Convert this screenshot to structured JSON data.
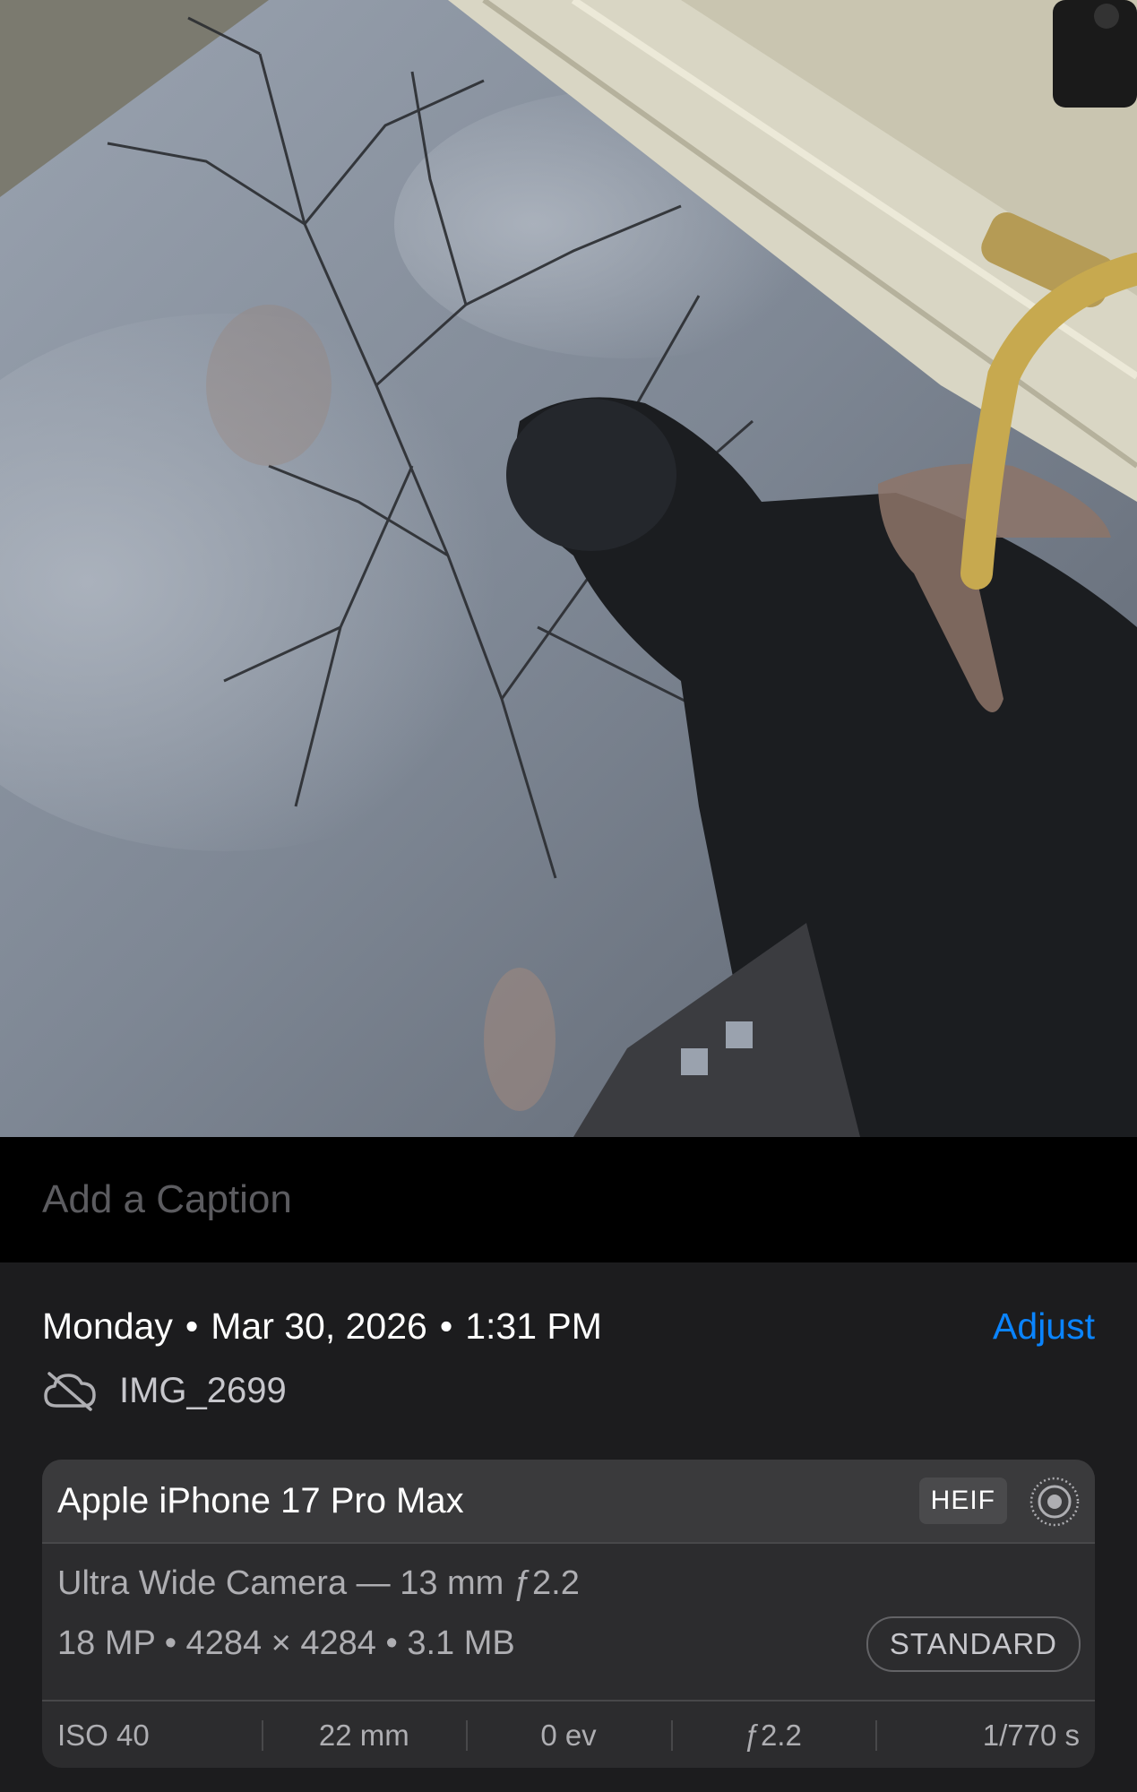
{
  "caption": {
    "placeholder": "Add a Caption"
  },
  "info": {
    "day": "Monday",
    "date": "Mar 30, 2026",
    "time": "1:31 PM",
    "separator": "•",
    "adjust_label": "Adjust",
    "filename": "IMG_2699",
    "cloud_icon": "icloud-slash-icon"
  },
  "camera": {
    "device": "Apple iPhone 17 Pro Max",
    "format": "HEIF",
    "live_icon": "live-photo-icon",
    "lens": "Ultra Wide Camera — 13 mm ƒ2.2",
    "specs": "18 MP  •  4284 × 4284  •  3.1 MB",
    "quality": "STANDARD",
    "exif": [
      "ISO 40",
      "22 mm",
      "0 ev",
      "ƒ2.2",
      "1/770 s"
    ]
  },
  "colors": {
    "accent": "#0a84ff",
    "panel": "#1c1c1e",
    "card": "#2c2c2e"
  }
}
